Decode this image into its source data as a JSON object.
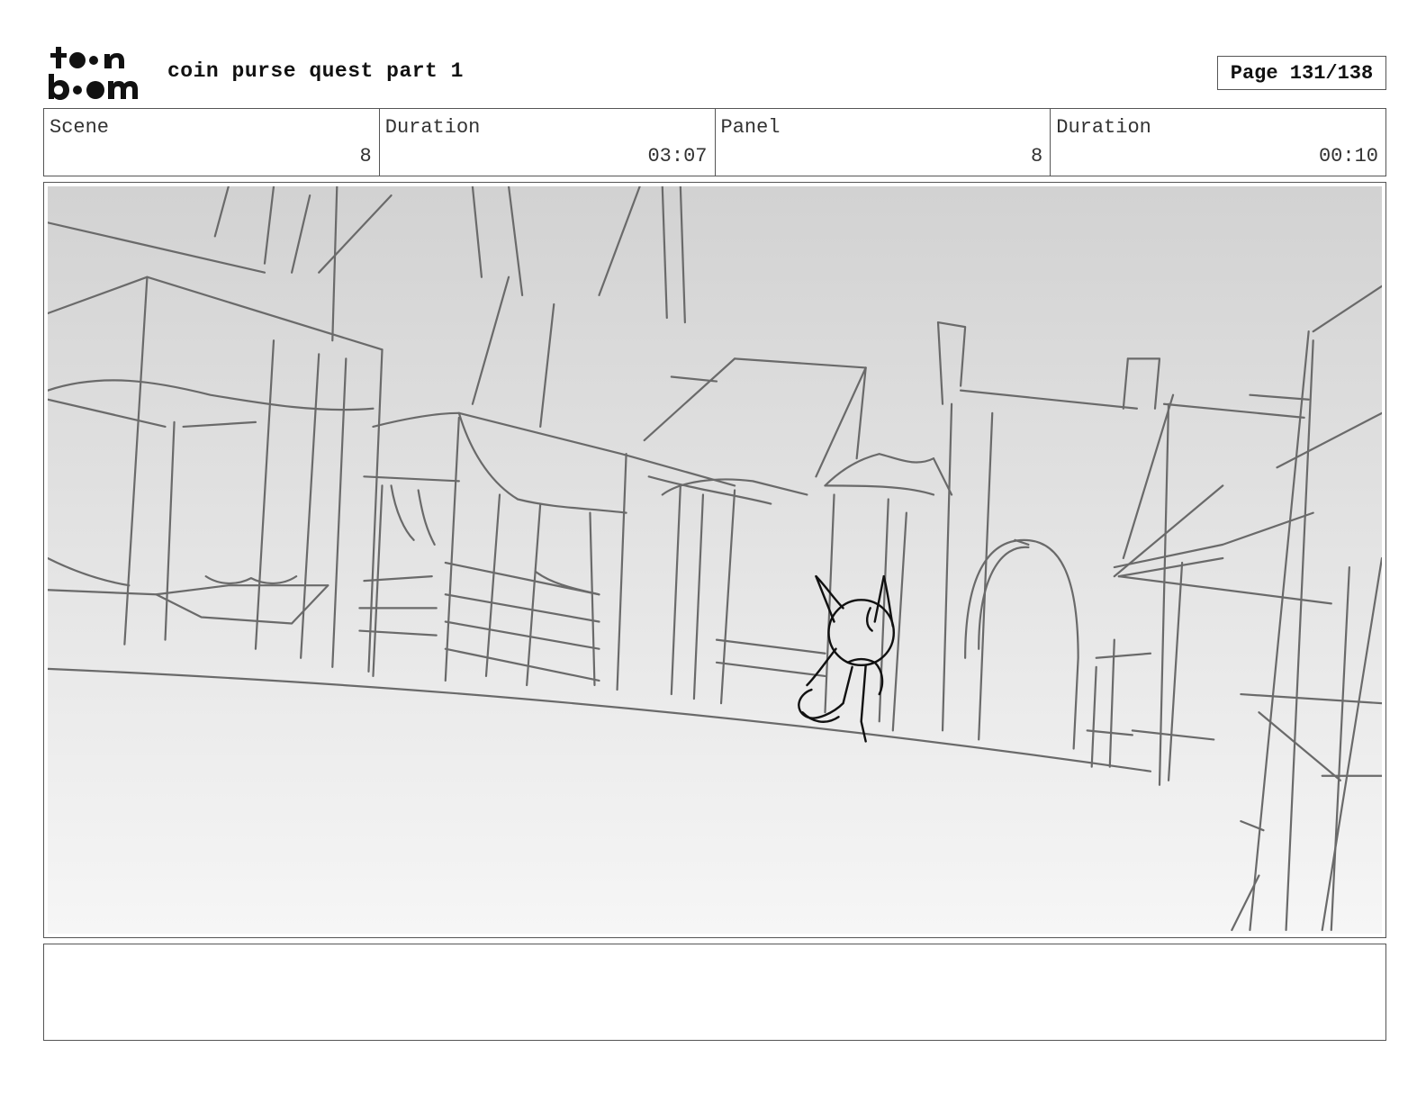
{
  "header": {
    "logo_text_top": "toon",
    "logo_text_bottom": "boom",
    "title": "coin purse quest part 1",
    "page_label": "Page 131/138"
  },
  "info": [
    {
      "label": "Scene",
      "value": "8"
    },
    {
      "label": "Duration",
      "value": "03:07"
    },
    {
      "label": "Panel",
      "value": "8"
    },
    {
      "label": "Duration",
      "value": "00:10"
    }
  ],
  "panel": {
    "image_icon": "sketch-image",
    "gradient_top": "#d2d2d2",
    "gradient_bottom": "#f6f6f6",
    "line_color": "#6a6a6a",
    "character_color": "#111111"
  },
  "notes": {
    "text": ""
  }
}
